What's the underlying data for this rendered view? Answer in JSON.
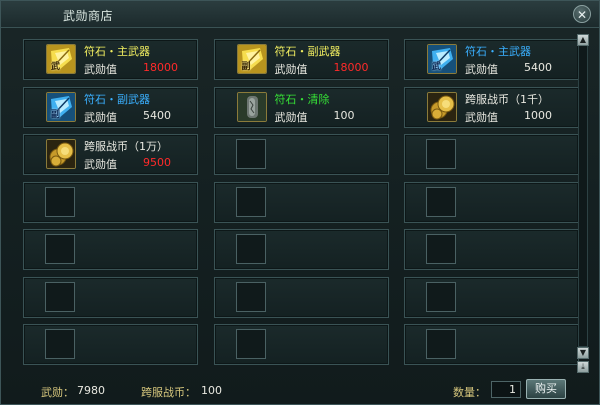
{
  "window": {
    "title": "武勋商店",
    "close_glyph": "✕"
  },
  "price_label": "武勋值",
  "items": [
    {
      "name": "符石・主武器",
      "price": "18000",
      "name_color": "#f2ef60",
      "price_color": "#ff2a2a",
      "icon": "gold-rune-sword-icon",
      "icon_char": "武"
    },
    {
      "name": "符石・副武器",
      "price": "18000",
      "name_color": "#f2ef60",
      "price_color": "#ff2a2a",
      "icon": "gold-rune-offhand-icon",
      "icon_char": "副"
    },
    {
      "name": "符石・主武器",
      "price": "5400",
      "name_color": "#3ab0ff",
      "price_color": "#e8e8e0",
      "icon": "blue-rune-sword-icon",
      "icon_char": "武"
    },
    {
      "name": "符石・副武器",
      "price": "5400",
      "name_color": "#3ab0ff",
      "price_color": "#e8e8e0",
      "icon": "blue-rune-offhand-icon",
      "icon_char": "副"
    },
    {
      "name": "符石・清除",
      "price": "100",
      "name_color": "#36e036",
      "price_color": "#e8e8e0",
      "icon": "stone-clear-icon",
      "icon_char": ""
    },
    {
      "name": "跨服战币（1千）",
      "price": "1000",
      "name_color": "#e8e8e0",
      "price_color": "#e8e8e0",
      "icon": "coin-pile-icon",
      "icon_char": ""
    },
    {
      "name": "跨服战币（1万）",
      "price": "9500",
      "name_color": "#e8e8e0",
      "price_color": "#ff2a2a",
      "icon": "coin-pile-icon",
      "icon_char": ""
    }
  ],
  "footer": {
    "honor_label": "武勋：",
    "honor_value": "7980",
    "coin_label": "跨服战币：",
    "coin_value": "100",
    "quantity_label": "数量：",
    "quantity_value": "1",
    "buy_label": "购买"
  },
  "scroll": {
    "up_glyph": "▲",
    "down_glyph": "▼",
    "bottom_glyph": "⤓"
  }
}
